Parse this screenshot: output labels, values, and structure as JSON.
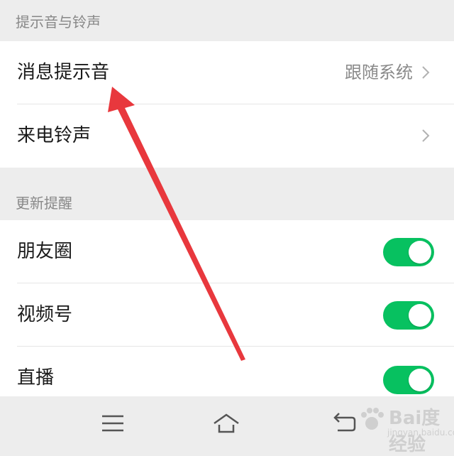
{
  "sections": [
    {
      "header": "提示音与铃声",
      "rows": [
        {
          "label": "消息提示音",
          "value": "跟随系统",
          "control": "chevron"
        },
        {
          "label": "来电铃声",
          "value": "",
          "control": "chevron"
        }
      ]
    },
    {
      "header": "更新提醒",
      "rows": [
        {
          "label": "朋友圈",
          "control": "toggle",
          "on": true
        },
        {
          "label": "视频号",
          "control": "toggle",
          "on": true
        },
        {
          "label": "直播",
          "control": "toggle",
          "on": true
        }
      ]
    }
  ],
  "navbar": {
    "icons": [
      "menu-icon",
      "home-icon",
      "back-icon"
    ]
  },
  "watermark": {
    "brand": "Bai度经验",
    "url": "jingyan.baidu.com"
  },
  "colors": {
    "toggle_on": "#07c160",
    "annotation_arrow": "#e8383d"
  }
}
